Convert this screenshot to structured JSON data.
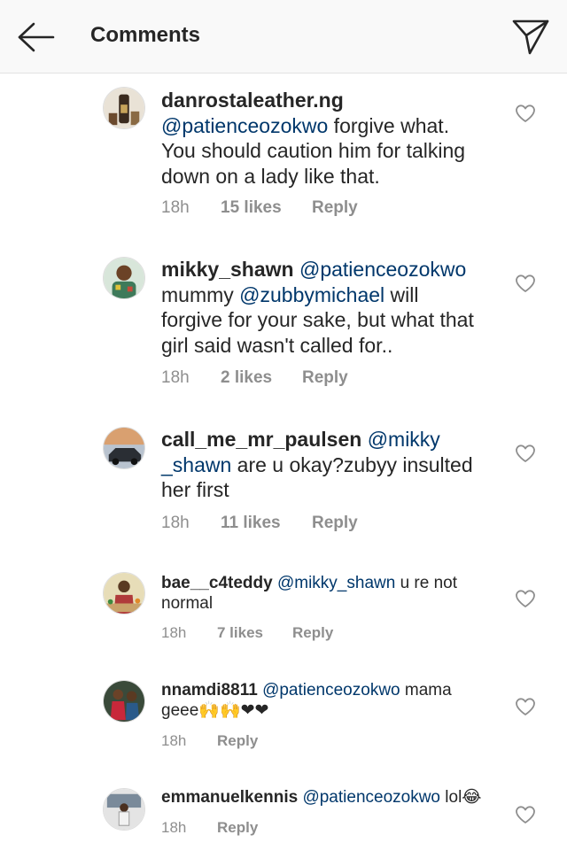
{
  "header": {
    "title": "Comments",
    "back_icon": "arrow-left-icon",
    "send_icon": "paper-plane-icon"
  },
  "colors": {
    "mention": "#00376b",
    "meta": "#8e8e8e",
    "text": "#262626",
    "topbar": "#f9f9f9"
  },
  "comments": [
    {
      "username": "danrostaleather.ng",
      "mention1": "@patienceozokwo",
      "line1_rest": " forgive what.",
      "line2": "You should caution him for talking",
      "line3": "down on a lady like that.",
      "time": "18h",
      "likes": "15 likes",
      "reply": "Reply"
    },
    {
      "username": "mikky_shawn",
      "mention1": "@patienceozokwo",
      "line2_start": "mummy ",
      "mention2": "@zubbymichael",
      "line2_rest": " will",
      "line3": "forgive for your sake, but what that",
      "line4": "girl said wasn't called for..",
      "time": "18h",
      "likes": "2 likes",
      "reply": "Reply"
    },
    {
      "username": "call_me_mr_paulsen",
      "mention1_part1": "@mikky",
      "mention1_part2": "_shawn",
      "line2_rest": " are u okay?zubyy insulted",
      "line3": "her first",
      "time": "18h",
      "likes": "11 likes",
      "reply": "Reply"
    },
    {
      "username": "bae__c4teddy",
      "mention1": "@mikky_shawn",
      "line1_rest": " u re not",
      "line2": "normal",
      "time": "18h",
      "likes": "7 likes",
      "reply": "Reply"
    },
    {
      "username": "nnamdi8811",
      "mention1": "@patienceozokwo",
      "line1_rest": " mama",
      "line2": "geee",
      "emojis": "🙌🙌❤❤",
      "time": "18h",
      "reply": "Reply"
    },
    {
      "username": "emmanuelkennis",
      "mention1": "@patienceozokwo",
      "line1_rest": " lol",
      "emoji": "😂",
      "time": "18h",
      "reply": "Reply"
    }
  ]
}
